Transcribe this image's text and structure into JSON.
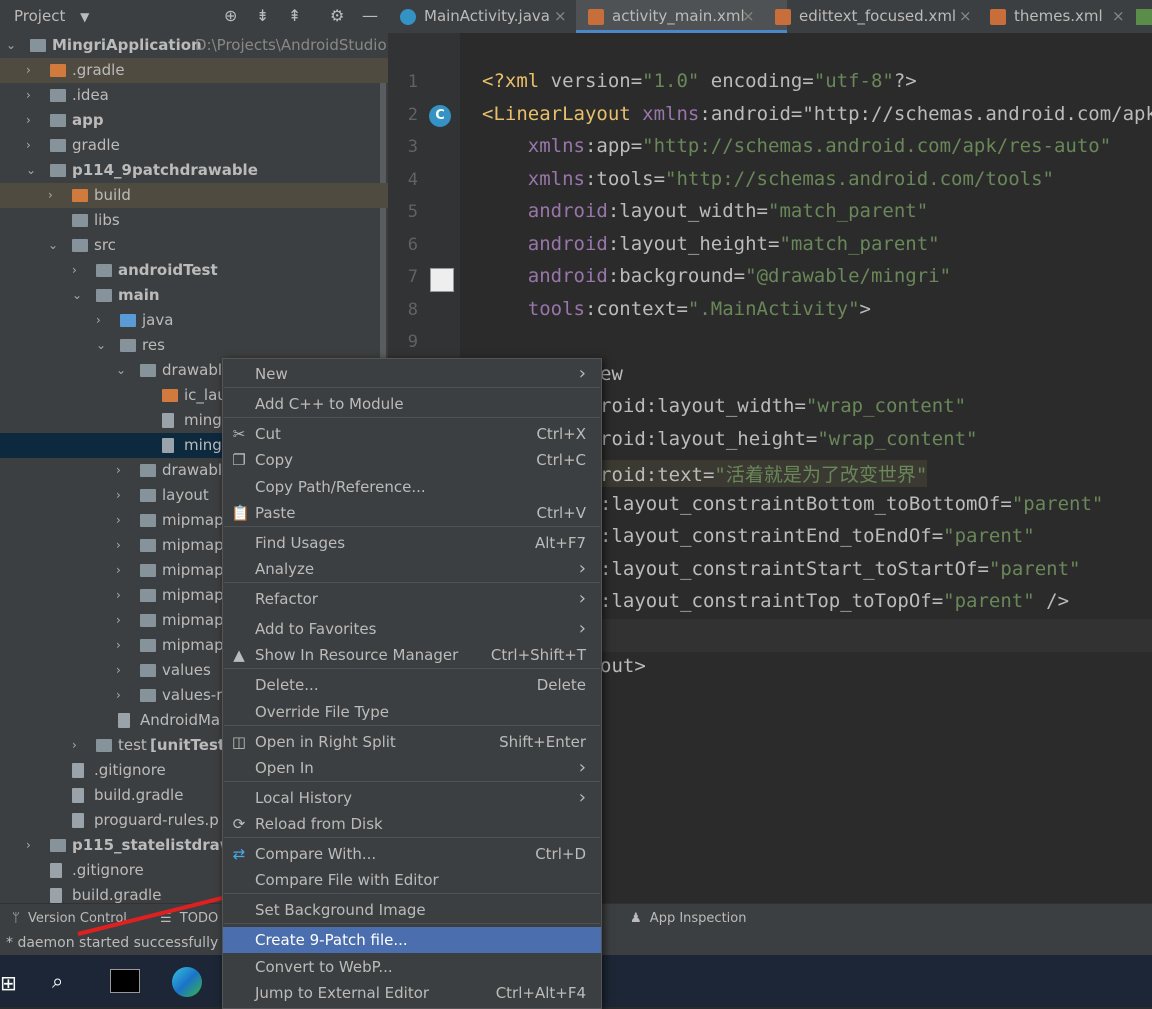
{
  "project_panel": {
    "title": "Project",
    "tree": [
      {
        "label": "MingriApplication",
        "path": "D:\\Projects\\AndroidStudio"
      },
      {
        "label": ".gradle"
      },
      {
        "label": ".idea"
      },
      {
        "label": "app"
      },
      {
        "label": "gradle"
      },
      {
        "label": "p114_9patchdrawable"
      },
      {
        "label": "build"
      },
      {
        "label": "libs"
      },
      {
        "label": "src"
      },
      {
        "label": "androidTest"
      },
      {
        "label": "main"
      },
      {
        "label": "java"
      },
      {
        "label": "res"
      },
      {
        "label": "drawabl"
      },
      {
        "label": "ic_lau"
      },
      {
        "label": "ming"
      },
      {
        "label": "ming"
      },
      {
        "label": "drawabl"
      },
      {
        "label": "layout"
      },
      {
        "label": "mipmap"
      },
      {
        "label": "mipmap"
      },
      {
        "label": "mipmap"
      },
      {
        "label": "mipmap"
      },
      {
        "label": "mipmap"
      },
      {
        "label": "mipmap"
      },
      {
        "label": "values"
      },
      {
        "label": "values-n"
      },
      {
        "label": "AndroidMa"
      },
      {
        "label": "test",
        "suffix": "[unitTest]"
      },
      {
        "label": ".gitignore"
      },
      {
        "label": "build.gradle"
      },
      {
        "label": "proguard-rules.p"
      },
      {
        "label": "p115_statelistdrawa"
      },
      {
        "label": ".gitignore"
      },
      {
        "label": "build.gradle"
      }
    ]
  },
  "editor_tabs": [
    {
      "label": "MainActivity.java"
    },
    {
      "label": "activity_main.xml"
    },
    {
      "label": "edittext_focused.xml"
    },
    {
      "label": "themes.xml"
    }
  ],
  "editor": {
    "line_numbers": [
      "1",
      "2",
      "3",
      "4",
      "5",
      "6",
      "7",
      "8",
      "9"
    ],
    "lines": [
      {
        "text": "<?xml version=\"1.0\" encoding=\"utf-8\"?>"
      },
      {
        "text": "<LinearLayout xmlns:android=\"http://schemas.android.com/apk/r"
      },
      {
        "text": "    xmlns:app=\"http://schemas.android.com/apk/res-auto\""
      },
      {
        "text": "    xmlns:tools=\"http://schemas.android.com/tools\""
      },
      {
        "text": "    android:layout_width=\"match_parent\""
      },
      {
        "text": "    android:layout_height=\"match_parent\""
      },
      {
        "text": "    android:background=\"@drawable/mingri\""
      },
      {
        "text": "    tools:context=\".MainActivity\">"
      },
      {
        "text": ""
      },
      {
        "text": "ew"
      },
      {
        "text": "roid:layout_width=\"wrap_content\""
      },
      {
        "text": "roid:layout_height=\"wrap_content\""
      },
      {
        "text": "roid:text=\"活着就是为了改变世界\""
      },
      {
        "text": ":layout_constraintBottom_toBottomOf=\"parent\""
      },
      {
        "text": ":layout_constraintEnd_toEndOf=\"parent\""
      },
      {
        "text": ":layout_constraintStart_toStartOf=\"parent\""
      },
      {
        "text": ":layout_constraintTop_toTopOf=\"parent\" />"
      },
      {
        "text": ""
      },
      {
        "text": "out>"
      }
    ]
  },
  "bottom_tabs": {
    "version_control": "Version Control",
    "todo": "TODO",
    "app_inspection": "App Inspection"
  },
  "status": "* daemon started successfully",
  "context_menu": [
    {
      "label": "New",
      "shortcut": ""
    },
    {
      "label": "Add C++ to Module",
      "shortcut": ""
    },
    {
      "label": "Cut",
      "shortcut": "Ctrl+X"
    },
    {
      "label": "Copy",
      "shortcut": "Ctrl+C"
    },
    {
      "label": "Copy Path/Reference...",
      "shortcut": ""
    },
    {
      "label": "Paste",
      "shortcut": "Ctrl+V"
    },
    {
      "label": "Find Usages",
      "shortcut": "Alt+F7"
    },
    {
      "label": "Analyze",
      "shortcut": ""
    },
    {
      "label": "Refactor",
      "shortcut": ""
    },
    {
      "label": "Add to Favorites",
      "shortcut": ""
    },
    {
      "label": "Show In Resource Manager",
      "shortcut": "Ctrl+Shift+T"
    },
    {
      "label": "Delete...",
      "shortcut": "Delete"
    },
    {
      "label": "Override File Type",
      "shortcut": ""
    },
    {
      "label": "Open in Right Split",
      "shortcut": "Shift+Enter"
    },
    {
      "label": "Open In",
      "shortcut": ""
    },
    {
      "label": "Local History",
      "shortcut": ""
    },
    {
      "label": "Reload from Disk",
      "shortcut": ""
    },
    {
      "label": "Compare With...",
      "shortcut": "Ctrl+D"
    },
    {
      "label": "Compare File with Editor",
      "shortcut": ""
    },
    {
      "label": "Set Background Image",
      "shortcut": ""
    },
    {
      "label": "Create 9-Patch file...",
      "shortcut": ""
    },
    {
      "label": "Convert to WebP...",
      "shortcut": ""
    },
    {
      "label": "Jump to External Editor",
      "shortcut": "Ctrl+Alt+F4"
    }
  ],
  "colors": {
    "selection": "#4b6eaf",
    "accent": "#4a88c7"
  }
}
